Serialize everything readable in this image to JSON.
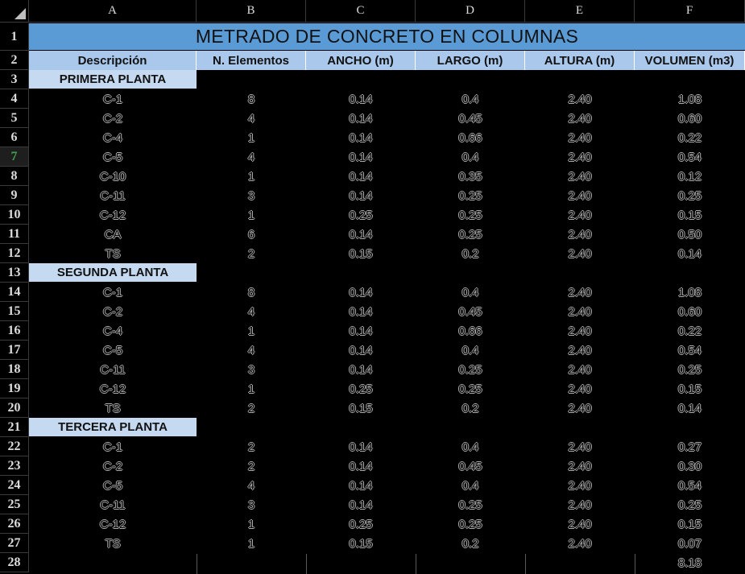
{
  "sheet": {
    "columns": [
      "A",
      "B",
      "C",
      "D",
      "E",
      "F"
    ],
    "rows": [
      "1",
      "2",
      "3",
      "4",
      "5",
      "6",
      "7",
      "8",
      "9",
      "10",
      "11",
      "12",
      "13",
      "14",
      "15",
      "16",
      "17",
      "18",
      "19",
      "20",
      "21",
      "22",
      "23",
      "24",
      "25",
      "26",
      "27",
      "28"
    ],
    "active_row": "7",
    "title": "METRADO DE CONCRETO EN COLUMNAS",
    "headers": [
      "Descripción",
      "N. Elementos",
      "ANCHO (m)",
      "LARGO (m)",
      "ALTURA (m)",
      "VOLUMEN (m3)"
    ],
    "sections": [
      {
        "name": "PRIMERA PLANTA",
        "items": [
          [
            "C-1",
            "8",
            "0.14",
            "0.4",
            "2.40",
            "1.08"
          ],
          [
            "C-2",
            "4",
            "0.14",
            "0.45",
            "2.40",
            "0.60"
          ],
          [
            "C-4",
            "1",
            "0.14",
            "0.66",
            "2.40",
            "0.22"
          ],
          [
            "C-5",
            "4",
            "0.14",
            "0.4",
            "2.40",
            "0.54"
          ],
          [
            "C-10",
            "1",
            "0.14",
            "0.35",
            "2.40",
            "0.12"
          ],
          [
            "C-11",
            "3",
            "0.14",
            "0.25",
            "2.40",
            "0.25"
          ],
          [
            "C-12",
            "1",
            "0.25",
            "0.25",
            "2.40",
            "0.15"
          ],
          [
            "CA",
            "6",
            "0.14",
            "0.25",
            "2.40",
            "0.50"
          ],
          [
            "TS",
            "2",
            "0.15",
            "0.2",
            "2.40",
            "0.14"
          ]
        ]
      },
      {
        "name": "SEGUNDA PLANTA",
        "items": [
          [
            "C-1",
            "8",
            "0.14",
            "0.4",
            "2.40",
            "1.08"
          ],
          [
            "C-2",
            "4",
            "0.14",
            "0.45",
            "2.40",
            "0.60"
          ],
          [
            "C-4",
            "1",
            "0.14",
            "0.66",
            "2.40",
            "0.22"
          ],
          [
            "C-5",
            "4",
            "0.14",
            "0.4",
            "2.40",
            "0.54"
          ],
          [
            "C-11",
            "3",
            "0.14",
            "0.25",
            "2.40",
            "0.25"
          ],
          [
            "C-12",
            "1",
            "0.25",
            "0.25",
            "2.40",
            "0.15"
          ],
          [
            "TS",
            "2",
            "0.15",
            "0.2",
            "2.40",
            "0.14"
          ]
        ]
      },
      {
        "name": "TERCERA PLANTA",
        "items": [
          [
            "C-1",
            "2",
            "0.14",
            "0.4",
            "2.40",
            "0.27"
          ],
          [
            "C-2",
            "2",
            "0.14",
            "0.45",
            "2.40",
            "0.30"
          ],
          [
            "C-5",
            "4",
            "0.14",
            "0.4",
            "2.40",
            "0.54"
          ],
          [
            "C-11",
            "3",
            "0.14",
            "0.25",
            "2.40",
            "0.25"
          ],
          [
            "C-12",
            "1",
            "0.25",
            "0.25",
            "2.40",
            "0.15"
          ],
          [
            "TS",
            "1",
            "0.15",
            "0.2",
            "2.40",
            "0.07"
          ]
        ]
      }
    ],
    "total": "8.18"
  }
}
